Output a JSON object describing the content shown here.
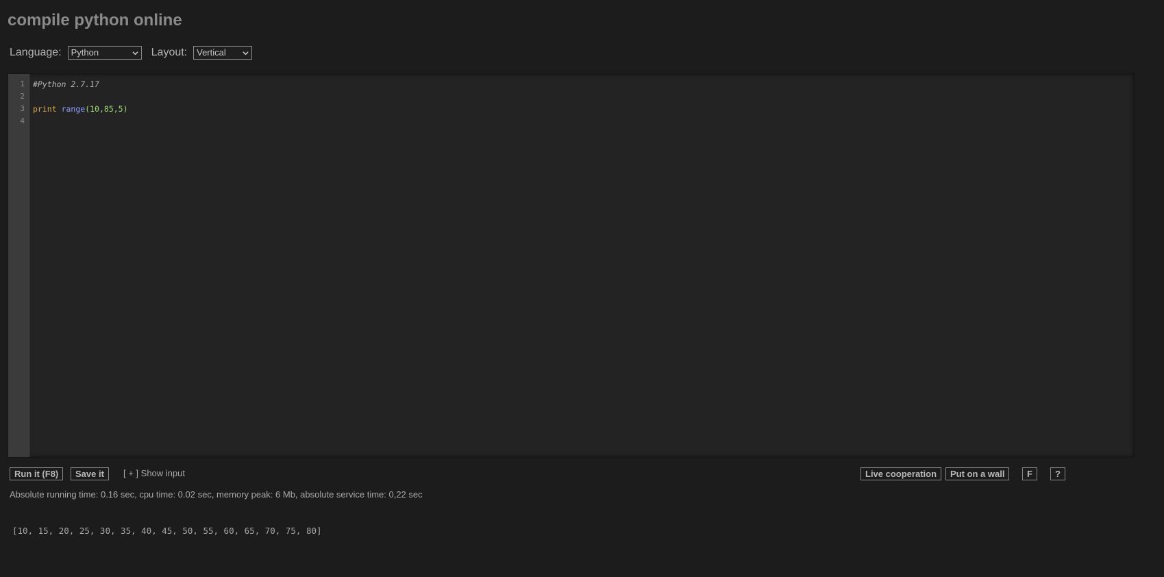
{
  "page": {
    "title": "compile python online"
  },
  "controls": {
    "language_label": "Language:",
    "language_value": "Python",
    "layout_label": "Layout:",
    "layout_value": "Vertical"
  },
  "editor": {
    "line_numbers": [
      "1",
      "2",
      "3",
      "4"
    ],
    "comment": "#Python 2.7.17",
    "keyword": "print",
    "builtin": "range",
    "open_paren": "(",
    "args": "10,85,5",
    "close_paren": ")"
  },
  "actions": {
    "run_label": "Run it (F8)",
    "save_label": "Save it",
    "show_input_label": "[ + ] Show input",
    "live_cooperation_label": "Live cooperation",
    "put_on_wall_label": "Put on a wall",
    "fullscreen_label": "F",
    "help_label": "?"
  },
  "result": {
    "stats": "Absolute running time: 0.16 sec, cpu time: 0.02 sec, memory peak: 6 Mb, absolute service time: 0,22 sec",
    "output": "[10, 15, 20, 25, 30, 35, 40, 45, 50, 55, 60, 65, 70, 75, 80]"
  },
  "colors": {
    "background": "#1c1c1c",
    "editor_bg": "#232323",
    "gutter_bg": "#3b3b3b",
    "comment": "#b7b7b7",
    "keyword": "#d4a84d",
    "builtin": "#8f9bff",
    "number": "#9fdc73"
  },
  "icons": {
    "select_arrow": "chevron-down-icon"
  }
}
